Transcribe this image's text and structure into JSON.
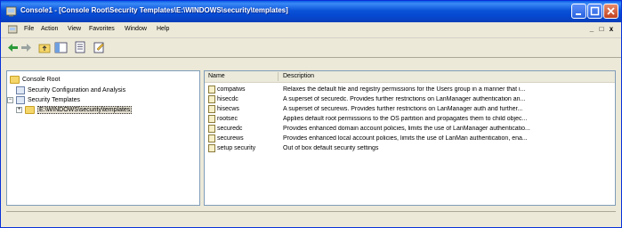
{
  "titlebar": {
    "title": "Console1 - [Console Root\\Security Templates\\E:\\WINDOWS\\security\\templates]"
  },
  "menubar": {
    "items": [
      "File",
      "Action",
      "View",
      "Favorites",
      "Window",
      "Help"
    ]
  },
  "mdi_controls": [
    "_",
    "□",
    "x"
  ],
  "tree": {
    "root": "Console Root",
    "items": [
      "Security Configuration and Analysis",
      "Security Templates",
      "E:\\WINDOWS\\security\\templates"
    ]
  },
  "list": {
    "columns": [
      "Name",
      "Description"
    ],
    "rows": [
      {
        "name": "compatws",
        "description": "Relaxes the default file and registry permissions for the Users group in a manner that i..."
      },
      {
        "name": "hisecdc",
        "description": "A superset of securedc. Provides further restrictions on LanManager authentication an..."
      },
      {
        "name": "hisecws",
        "description": "A superset of securews. Provides further restrictions on LanManager auth and further..."
      },
      {
        "name": "rootsec",
        "description": "Applies default root permissions to the OS partition and propagates them to child objec..."
      },
      {
        "name": "securedc",
        "description": "Provides enhanced domain account policies, limits the use of LanManager authenticatio..."
      },
      {
        "name": "securews",
        "description": "Provides enhanced local account policies, limits the use of LanMan authentication, ena..."
      },
      {
        "name": "setup security",
        "description": "Out of box default security settings"
      }
    ]
  },
  "colors": {
    "titlebar": "#0a53d8",
    "selection": "#e2ddcf"
  }
}
